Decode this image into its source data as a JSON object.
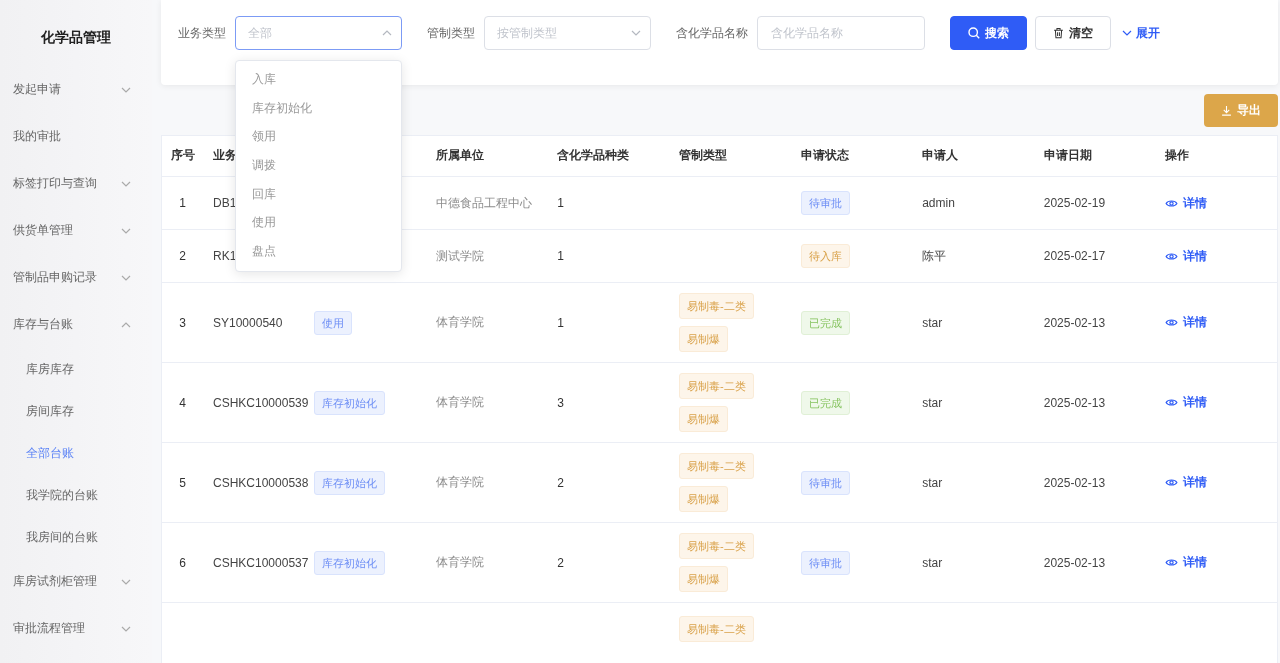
{
  "sidebar": {
    "title": "化学品管理",
    "items": [
      {
        "kind": "group",
        "label": "发起申请",
        "expanded": false
      },
      {
        "kind": "link",
        "label": "我的审批",
        "selected": false
      },
      {
        "kind": "group",
        "label": "标签打印与查询",
        "expanded": false
      },
      {
        "kind": "group",
        "label": "供货单管理",
        "expanded": false
      },
      {
        "kind": "group",
        "label": "管制品申购记录",
        "expanded": false
      },
      {
        "kind": "group",
        "label": "库存与台账",
        "expanded": true,
        "children": [
          {
            "label": "库房库存",
            "selected": false
          },
          {
            "label": "房间库存",
            "selected": false
          },
          {
            "label": "全部台账",
            "selected": true
          },
          {
            "label": "我学院的台账",
            "selected": false
          },
          {
            "label": "我房间的台账",
            "selected": false
          }
        ]
      },
      {
        "kind": "group",
        "label": "库房试剂柜管理",
        "expanded": false
      },
      {
        "kind": "group",
        "label": "审批流程管理",
        "expanded": false
      }
    ]
  },
  "filters": [
    {
      "kind": "select",
      "label": "业务类型",
      "placeholder": "全部",
      "open": true,
      "options": [
        "入库",
        "库存初始化",
        "领用",
        "调拨",
        "回库",
        "使用",
        "盘点"
      ]
    },
    {
      "kind": "select",
      "label": "管制类型",
      "placeholder": "按管制类型",
      "open": false
    },
    {
      "kind": "input",
      "label": "含化学品名称",
      "placeholder": "含化学品名称"
    }
  ],
  "filter_actions": [
    {
      "kind": "search",
      "label": "搜索"
    },
    {
      "kind": "clear",
      "label": "清空"
    },
    {
      "kind": "expand",
      "label": "展开"
    }
  ],
  "export_button": {
    "label": "导出"
  },
  "table": {
    "columns": [
      {
        "label": "序号"
      },
      {
        "label": "业务"
      },
      {},
      {
        "label": "所属单位"
      },
      {
        "label": "含化学品种类"
      },
      {
        "label": "管制类型"
      },
      {
        "label": "申请状态"
      },
      {
        "label": "申请人"
      },
      {
        "label": "申请日期"
      },
      {
        "label": "操作"
      }
    ],
    "rows": [
      {
        "seq": "1",
        "column_2": "DB1",
        "unit": "中德食品工程中心",
        "chemical_types": "1",
        "status": {
          "kind": "pending",
          "label": "待审批"
        },
        "applicant": "admin",
        "date": "2025-02-19",
        "action": "详情"
      },
      {
        "seq": "2",
        "column_2": "RK1",
        "unit": "测试学院",
        "chemical_types": "1",
        "status": {
          "kind": "awaiting_stock",
          "label": "待入库"
        },
        "applicant": "陈平",
        "date": "2025-02-17",
        "action": "详情"
      },
      {
        "seq": "3",
        "column_2": "SY10000540",
        "column_3": "使用",
        "unit": "体育学院",
        "chemical_types": "1",
        "control_types": [
          "易制毒-二类",
          "易制爆"
        ],
        "status": {
          "kind": "completed",
          "label": "已完成"
        },
        "applicant": "star",
        "date": "2025-02-13",
        "action": "详情"
      },
      {
        "seq": "4",
        "column_2": "CSHKC10000539",
        "column_3": "库存初始化",
        "unit": "体育学院",
        "chemical_types": "3",
        "control_types": [
          "易制毒-二类",
          "易制爆"
        ],
        "status": {
          "kind": "completed",
          "label": "已完成"
        },
        "applicant": "star",
        "date": "2025-02-13",
        "action": "详情"
      },
      {
        "seq": "5",
        "column_2": "CSHKC10000538",
        "column_3": "库存初始化",
        "unit": "体育学院",
        "chemical_types": "2",
        "control_types": [
          "易制毒-二类",
          "易制爆"
        ],
        "status": {
          "kind": "pending",
          "label": "待审批"
        },
        "applicant": "star",
        "date": "2025-02-13",
        "action": "详情"
      },
      {
        "seq": "6",
        "column_2": "CSHKC10000537",
        "column_3": "库存初始化",
        "unit": "体育学院",
        "chemical_types": "2",
        "control_types": [
          "易制毒-二类",
          "易制爆"
        ],
        "status": {
          "kind": "pending",
          "label": "待审批"
        },
        "applicant": "star",
        "date": "2025-02-13",
        "action": "详情"
      },
      {
        "control_types": [
          "易制毒-二类"
        ]
      }
    ]
  }
}
